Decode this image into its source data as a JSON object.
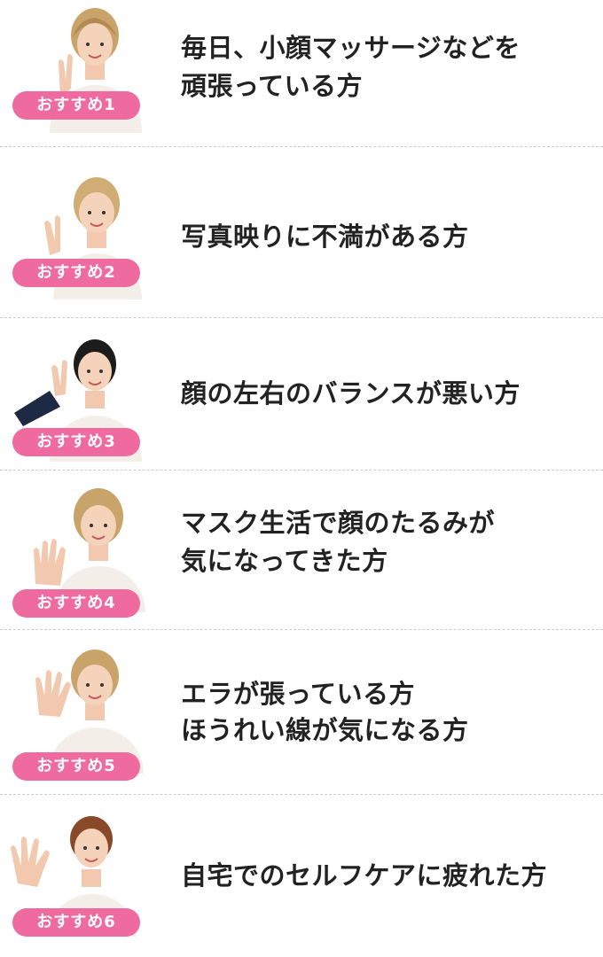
{
  "colors": {
    "badge_background": "#ef6a9e",
    "badge_text": "#ffffff",
    "body_text": "#222222",
    "divider": "#cccccc"
  },
  "items": [
    {
      "badge": "おすすめ1",
      "lines": [
        "毎日、小顔マッサージなどを",
        "頑張っている方"
      ],
      "photo": "staff-peace-sign-photo"
    },
    {
      "badge": "おすすめ2",
      "lines": [
        "写真映りに不満がある方"
      ],
      "photo": "staff-peace-sign-photo"
    },
    {
      "badge": "おすすめ3",
      "lines": [
        "顔の左右のバランスが悪い方"
      ],
      "photo": "staff-peace-sign-photo"
    },
    {
      "badge": "おすすめ4",
      "lines": [
        "マスク生活で顔のたるみが",
        "気になってきた方"
      ],
      "photo": "staff-open-hand-photo"
    },
    {
      "badge": "おすすめ5",
      "lines": [
        "エラが張っている方",
        "ほうれい線が気になる方"
      ],
      "photo": "staff-open-hand-photo"
    },
    {
      "badge": "おすすめ6",
      "lines": [
        "自宅でのセルフケアに疲れた方"
      ],
      "photo": "staff-open-hand-photo"
    }
  ]
}
